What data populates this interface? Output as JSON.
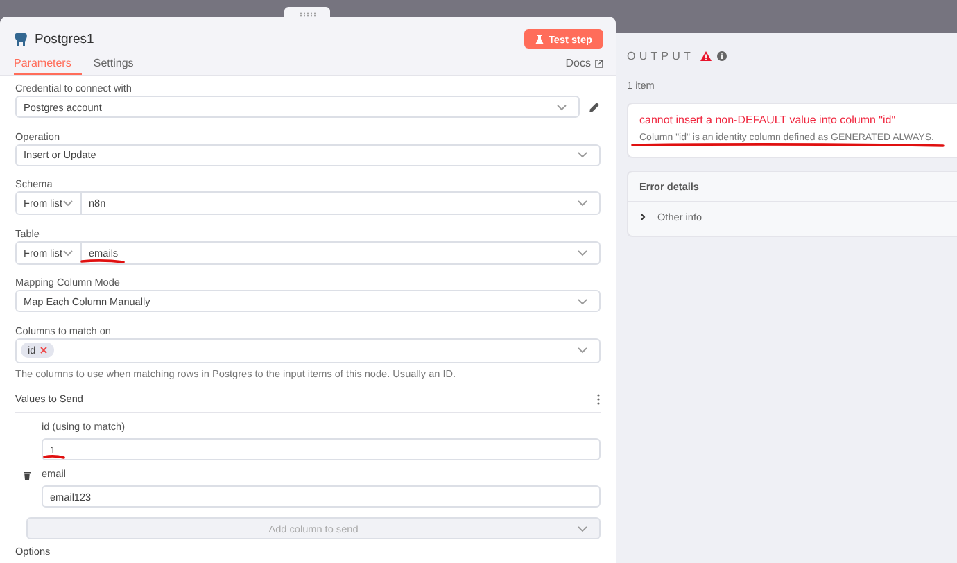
{
  "node": {
    "title": "Postgres1",
    "test_button": "Test step",
    "docs_link": "Docs",
    "tabs": [
      {
        "label": "Parameters",
        "selected": true
      },
      {
        "label": "Settings",
        "selected": false
      }
    ]
  },
  "parameters": [
    {
      "kind": "select",
      "label": "Credential to connect with",
      "value": "Postgres account",
      "editable": true,
      "underlined": false
    },
    {
      "kind": "select",
      "label": "Operation",
      "value": "Insert or Update",
      "editable": false,
      "underlined": false
    },
    {
      "kind": "resource",
      "label": "Schema",
      "mode": "From list",
      "value": "n8n",
      "underlined": false
    },
    {
      "kind": "resource",
      "label": "Table",
      "mode": "From list",
      "value": "emails",
      "underlined": true
    },
    {
      "kind": "select",
      "label": "Mapping Column Mode",
      "value": "Map Each Column Manually",
      "editable": false,
      "underlined": false
    },
    {
      "kind": "multi",
      "label": "Columns to match on",
      "chips": [
        "id"
      ],
      "hint": "The columns to use when matching rows in Postgres to the input items of this node. Usually an ID."
    }
  ],
  "values_to_send": {
    "title": "Values to Send",
    "add_button": "Add column to send",
    "fields": [
      {
        "kind": "match",
        "label": "id (using to match)",
        "value": "1",
        "underlined": true
      },
      {
        "kind": "column",
        "label": "email",
        "value": "email123",
        "underlined": false
      }
    ]
  },
  "options_title": "Options",
  "output": {
    "title": "OUTPUT",
    "item_count": "1 item",
    "error": {
      "message": "cannot insert a non-DEFAULT value into column \"id\"",
      "description": "Column \"id\" is an identity column defined as GENERATED ALWAYS.",
      "underlined": true
    },
    "details": {
      "title": "Error details",
      "sections": [
        {
          "label": "Other info",
          "expanded": false
        }
      ]
    }
  }
}
